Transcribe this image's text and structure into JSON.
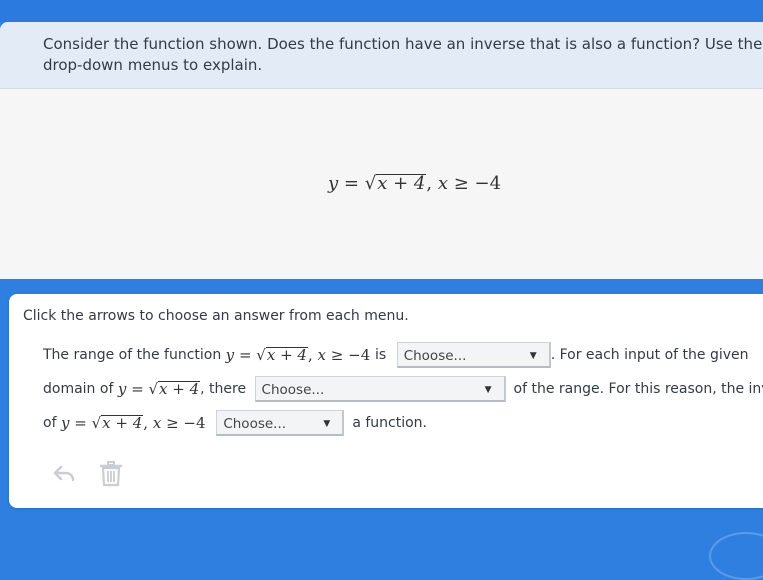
{
  "prompt": {
    "line1": "Consider the function shown. Does the function have an inverse that is also a function? Use the",
    "line2": "drop-down menus to explain."
  },
  "equation": {
    "lhs": "y",
    "eq": "=",
    "radicand": "x + 4",
    "comma": ",",
    "domain_var": "x",
    "geq": "≥",
    "bound": "−4"
  },
  "answer": {
    "instruction": "Click the arrows to choose an answer from each menu.",
    "line1_prefix": "The range of the function",
    "line1_is": "is",
    "line1_suffix": ". For each input of the given",
    "line2_prefix": "domain of",
    "line2_there": ", there",
    "line2_suffix": "of the range. For this reason, the inverse",
    "line3_prefix": "of",
    "line3_suffix": "a function.",
    "dropdown1": "Choose...",
    "dropdown2": "Choose...",
    "dropdown3": "Choose..."
  },
  "toolbar": {
    "undo_icon": "undo-arrow-icon",
    "delete_icon": "trash-icon"
  },
  "colors": {
    "background": "#2f7fe0",
    "prompt_bar": "#e3ebf6",
    "icon_gray": "#c9ced4"
  }
}
